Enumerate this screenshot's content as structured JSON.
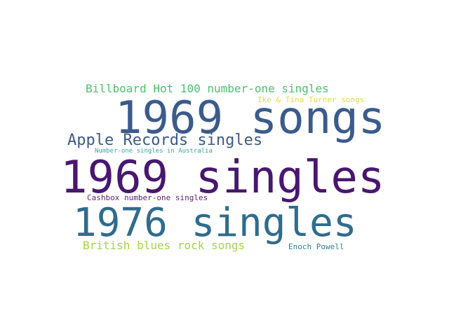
{
  "words": [
    {
      "key": "billboard",
      "text": "Billboard Hot 100 number-one singles",
      "color": "#4cc26c"
    },
    {
      "key": "ike_tina",
      "text": "Ike & Tina Turner songs",
      "color": "#e0dd3a"
    },
    {
      "key": "songs_1969",
      "text": "1969 songs",
      "color": "#3b5b8c"
    },
    {
      "key": "apple",
      "text": "Apple Records singles",
      "color": "#3d5a89"
    },
    {
      "key": "australia",
      "text": "Number-one singles in Australia",
      "color": "#31a6a0"
    },
    {
      "key": "singles_1969",
      "text": "1969 singles",
      "color": "#48176f"
    },
    {
      "key": "cashbox",
      "text": "Cashbox number-one singles",
      "color": "#5c1f73"
    },
    {
      "key": "singles_1976",
      "text": "1976 singles",
      "color": "#2f6c8e"
    },
    {
      "key": "british",
      "text": "British blues rock songs",
      "color": "#a6d441"
    },
    {
      "key": "enoch",
      "text": "Enoch Powell",
      "color": "#2e7f8e"
    }
  ]
}
